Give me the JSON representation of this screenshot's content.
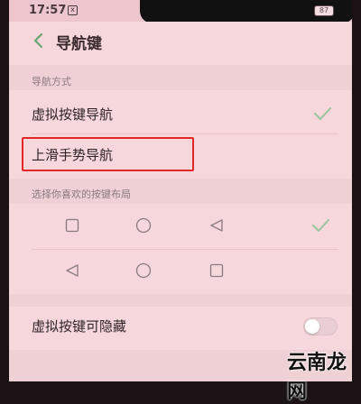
{
  "status": {
    "time": "17:57",
    "badge": "x",
    "battery": "87"
  },
  "header": {
    "title": "导航键",
    "back_icon": "chevron-left-icon"
  },
  "nav_section": {
    "label": "导航方式",
    "options": [
      {
        "label": "虚拟按键导航",
        "selected": true
      },
      {
        "label": "上滑手势导航",
        "selected": false
      }
    ]
  },
  "layout_section": {
    "label": "选择你喜欢的按键布局",
    "layouts": [
      {
        "icons": [
          "square-icon",
          "circle-icon",
          "triangle-left-icon"
        ],
        "selected": true
      },
      {
        "icons": [
          "triangle-left-icon",
          "circle-icon",
          "square-icon"
        ],
        "selected": false
      }
    ]
  },
  "hide_toggle": {
    "label": "虚拟按键可隐藏",
    "enabled": false
  },
  "watermark": "云南龙网",
  "colors": {
    "background": "#f6d7dc",
    "accent": "#9ac39e",
    "highlight": "#e32727"
  }
}
